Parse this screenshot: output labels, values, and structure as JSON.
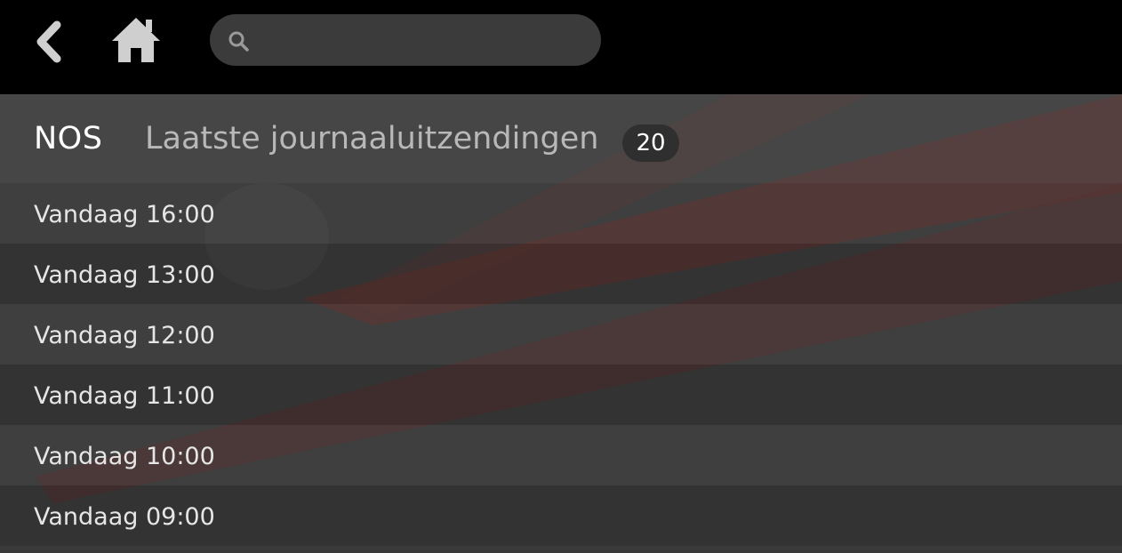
{
  "toolbar": {
    "back_icon": "chevron-left-icon",
    "home_icon": "home-icon",
    "search": {
      "icon": "search-icon",
      "value": "",
      "placeholder": ""
    }
  },
  "header": {
    "channel": "NOS",
    "title": "Laatste journaaluitzendingen",
    "count": "20"
  },
  "items": [
    {
      "label": "Vandaag 16:00"
    },
    {
      "label": "Vandaag 13:00"
    },
    {
      "label": "Vandaag 12:00"
    },
    {
      "label": "Vandaag 11:00"
    },
    {
      "label": "Vandaag 10:00"
    },
    {
      "label": "Vandaag 09:00"
    }
  ],
  "colors": {
    "topbar": "#000000",
    "accent_red": "#8a2a22",
    "text": "#e6e6e6"
  }
}
